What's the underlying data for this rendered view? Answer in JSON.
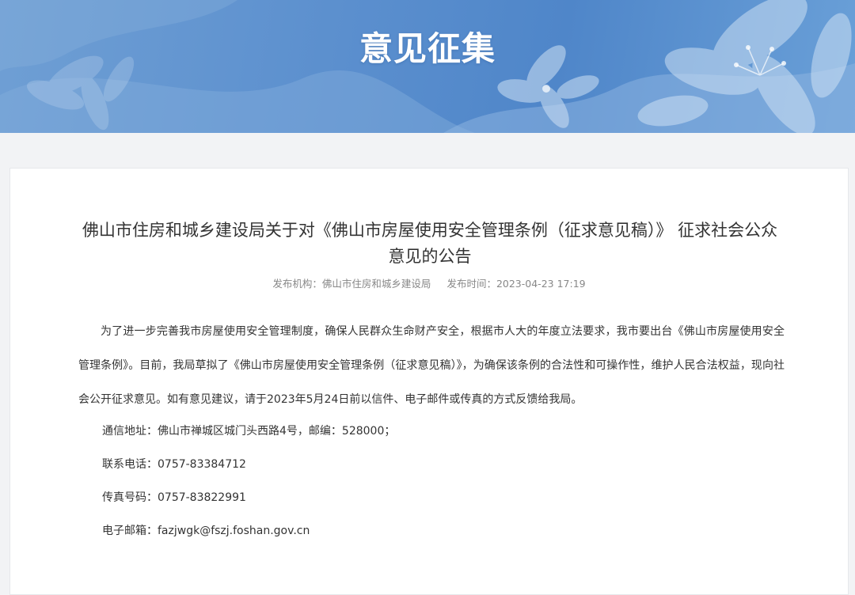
{
  "banner": {
    "title": "意见征集"
  },
  "article": {
    "title": "佛山市住房和城乡建设局关于对《佛山市房屋使用安全管理条例（征求意见稿）》 征求社会公众意见的公告",
    "meta": {
      "publisher_label": "发布机构：",
      "publisher": "佛山市住房和城乡建设局",
      "time_label": "发布时间：",
      "time": "2023-04-23 17:19"
    },
    "body": "为了进一步完善我市房屋使用安全管理制度，确保人民群众生命财产安全，根据市人大的年度立法要求，我市要出台《佛山市房屋使用安全管理条例》。目前，我局草拟了《佛山市房屋使用安全管理条例（征求意见稿）》，为确保该条例的合法性和可操作性，维护人民合法权益，现向社会公开征求意见。如有意见建议，请于2023年5月24日前以信件、电子邮件或传真的方式反馈给我局。",
    "contacts": {
      "address": "通信地址：佛山市禅城区城门头西路4号，邮编：528000；",
      "phone": "联系电话：0757-83384712",
      "fax": "传真号码：0757-83822991",
      "email": "电子邮箱：fazjwgk@fszj.foshan.gov.cn"
    }
  }
}
